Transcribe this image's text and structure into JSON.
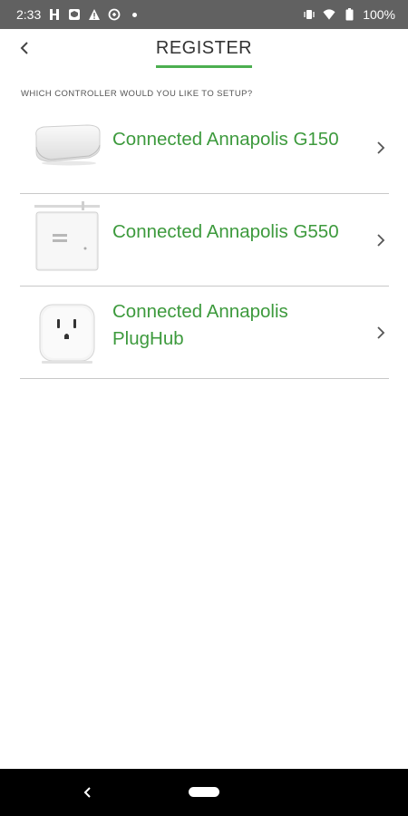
{
  "status_bar": {
    "time": "2:33",
    "battery": "100%",
    "icons": [
      "transit-icon",
      "shield-icon",
      "warning-icon",
      "data-saver-icon",
      "dot-icon",
      "vibrate-icon",
      "wifi-icon",
      "battery-icon"
    ]
  },
  "header": {
    "title": "REGISTER",
    "back_icon": "chevron-left-icon",
    "accent_color": "#4caf50"
  },
  "section_label": "WHICH CONTROLLER WOULD YOU LIKE TO SETUP?",
  "controllers": [
    {
      "label": "Connected Annapolis G150",
      "image": "g150-device-image"
    },
    {
      "label": "Connected Annapolis G550",
      "image": "g550-device-image"
    },
    {
      "label": "Connected Annapolis\nPlugHub",
      "image": "plughub-device-image"
    }
  ],
  "colors": {
    "item_text": "#3d9a3d",
    "status_bar": "#616161"
  },
  "nav_bar": {
    "back_icon": "nav-back-icon",
    "home_icon": "nav-home-pill"
  }
}
